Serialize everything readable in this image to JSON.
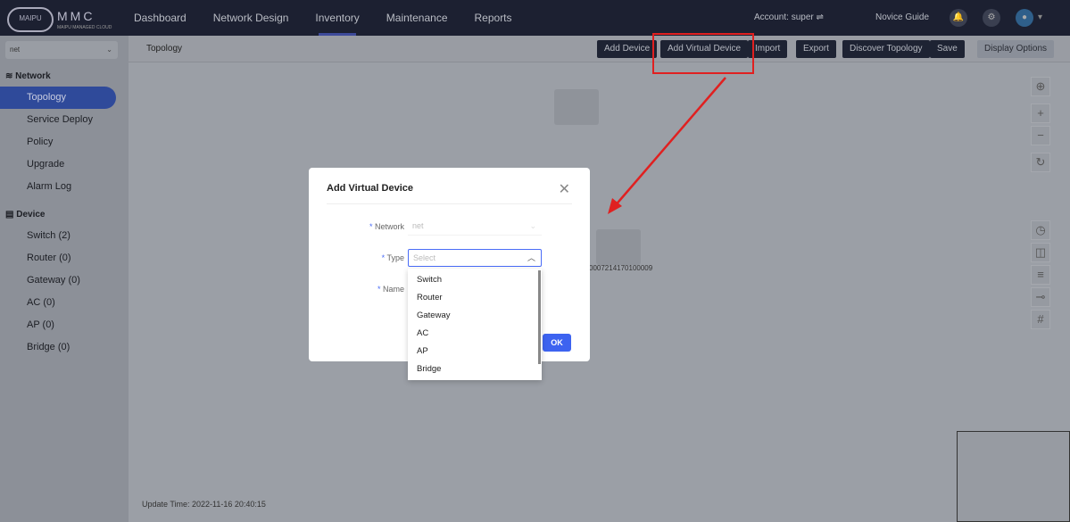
{
  "header": {
    "logo_text": "MAIPU",
    "brand": "MMC",
    "brand_sub": "MAIPU MANAGED CLOUD",
    "nav": [
      "Dashboard",
      "Network Design",
      "Inventory",
      "Maintenance",
      "Reports"
    ],
    "active_nav": "Inventory",
    "account": "Account: super ⇌",
    "novice_guide": "Novice Guide"
  },
  "sidebar": {
    "network_select": "net",
    "network_section": "Network",
    "network_items": [
      "Topology",
      "Service Deploy",
      "Policy",
      "Upgrade",
      "Alarm Log"
    ],
    "device_section": "Device",
    "device_items": [
      "Switch (2)",
      "Router (0)",
      "Gateway (0)",
      "AC (0)",
      "AP (0)",
      "Bridge (0)"
    ]
  },
  "toolbar": {
    "breadcrumb": "Topology",
    "buttons": [
      "Add Device",
      "Add Virtual Device",
      "Import",
      "Export",
      "Discover Topology",
      "Save"
    ],
    "display_options": "Display Options"
  },
  "topology": {
    "node_label": "0007214170100009",
    "update_time": "Update Time:  2022-11-16 20:40:15"
  },
  "modal": {
    "title": "Add Virtual Device",
    "network_label": "Network",
    "network_value": "net",
    "type_label": "Type",
    "type_placeholder": "Select",
    "name_label": "Name",
    "ok": "OK",
    "type_options": [
      "Switch",
      "Router",
      "Gateway",
      "AC",
      "AP",
      "Bridge"
    ]
  },
  "colors": {
    "accent": "#3d63f0",
    "highlight": "#e02020"
  }
}
